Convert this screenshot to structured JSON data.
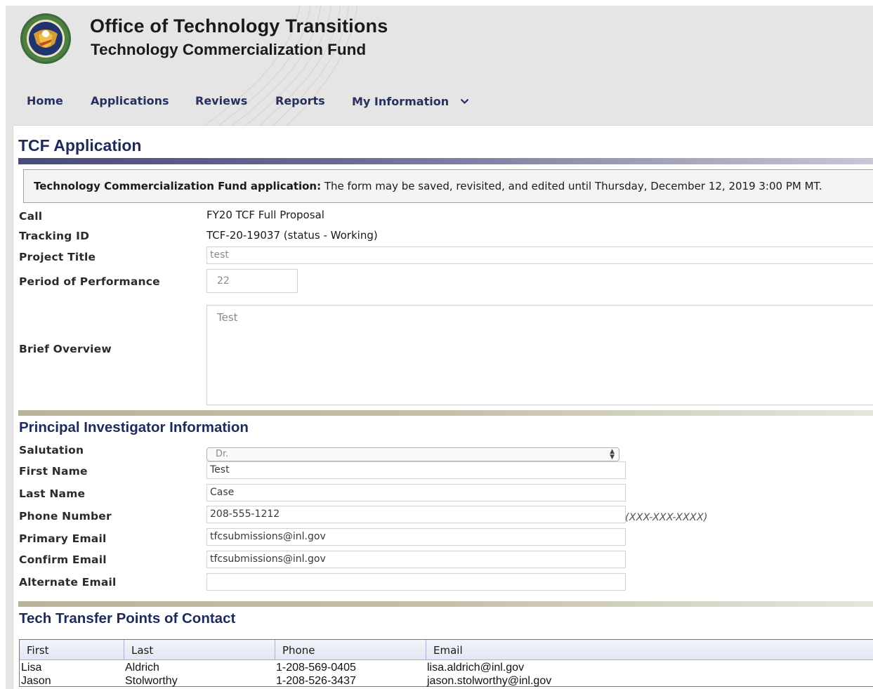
{
  "header": {
    "title": "Office of Technology Transitions",
    "subtitle": "Technology Commercialization Fund",
    "seal_icon": "doe-seal-icon"
  },
  "nav": {
    "items": [
      {
        "label": "Home"
      },
      {
        "label": "Applications"
      },
      {
        "label": "Reviews"
      },
      {
        "label": "Reports"
      },
      {
        "label": "My Information"
      }
    ],
    "dropdown_icon": "chevron-down-icon"
  },
  "page": {
    "title": "TCF Application",
    "notice_bold": "Technology Commercialization Fund application:",
    "notice_text": " The form may be saved, revisited, and edited until Thursday, December 12, 2019 3:00 PM MT."
  },
  "application": {
    "call_label": "Call",
    "call_value": "FY20 TCF Full Proposal",
    "tracking_label": "Tracking ID",
    "tracking_value": "TCF-20-19037 (status - Working)",
    "project_title_label": "Project Title",
    "project_title_value": "test",
    "period_label": "Period of Performance",
    "period_value": "22",
    "overview_label": "Brief Overview",
    "overview_value": "Test"
  },
  "pi": {
    "section_title": "Principal Investigator Information",
    "salutation_label": "Salutation",
    "salutation_value": "Dr.",
    "first_name_label": "First Name",
    "first_name_value": "Test",
    "last_name_label": "Last Name",
    "last_name_value": "Case",
    "phone_label": "Phone Number",
    "phone_value": "208-555-1212",
    "phone_hint": "(XXX-XXX-XXXX)",
    "primary_email_label": "Primary Email",
    "primary_email_value": "tfcsubmissions@inl.gov",
    "confirm_email_label": "Confirm Email",
    "confirm_email_value": "tfcsubmissions@inl.gov",
    "alternate_email_label": "Alternate Email",
    "alternate_email_value": ""
  },
  "poc": {
    "section_title": "Tech Transfer Points of Contact",
    "columns": [
      "First",
      "Last",
      "Phone",
      "Email"
    ],
    "rows": [
      {
        "first": "Lisa",
        "last": "Aldrich",
        "phone": "1-208-569-0405",
        "email": "lisa.aldrich@inl.gov"
      },
      {
        "first": "Jason",
        "last": "Stolworthy",
        "phone": "1-208-526-3437",
        "email": "jason.stolworthy@inl.gov"
      }
    ]
  },
  "colors": {
    "nav_text": "#27305e",
    "heading": "#1f2a5c",
    "title_rule": "#474a7e",
    "section_rule": "#b7b49a"
  }
}
